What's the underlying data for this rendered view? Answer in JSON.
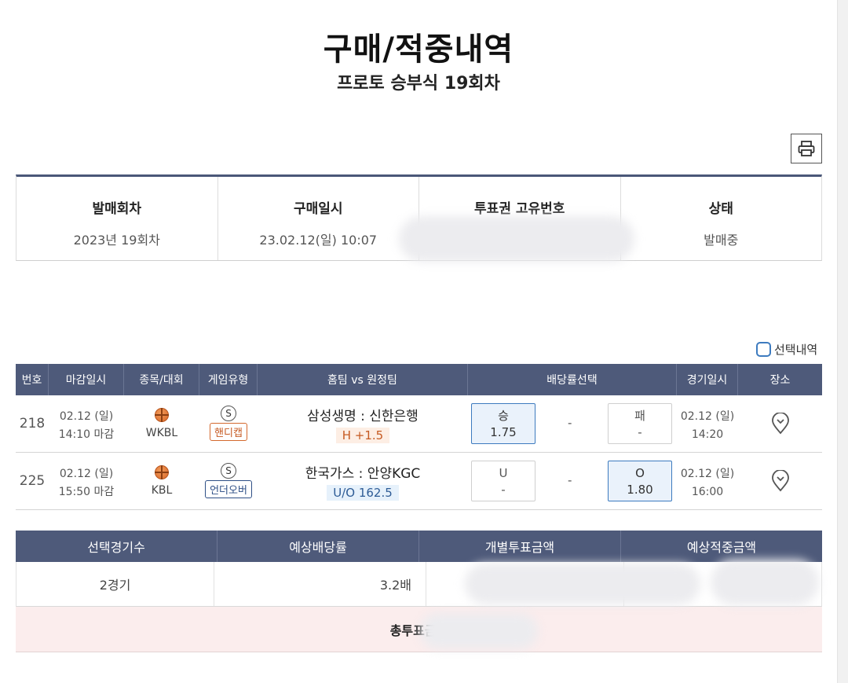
{
  "page": {
    "title": "구매/적중내역",
    "subtitle": "프로토 승부식 19회차"
  },
  "info": {
    "headers": [
      "발매회차",
      "구매일시",
      "투표권 고유번호",
      "상태"
    ],
    "values": [
      "2023년 19회차",
      "23.02.12(일) 10:07",
      "",
      "발매중"
    ]
  },
  "selection_toggle": {
    "label": "선택내역"
  },
  "games": {
    "headers": [
      "번호",
      "마감일시",
      "종목/대회",
      "게임유형",
      "홈팀 vs 원정팀",
      "배당률선택",
      "경기일시",
      "장소"
    ],
    "rows": [
      {
        "no": "218",
        "close_date": "02.12 (일)",
        "close_time": "14:10 마감",
        "league": "WKBL",
        "type_badge": "S",
        "type": "핸디캡",
        "teams": "삼성생명 : 신한은행",
        "line": "H +1.5",
        "odd_left_label": "승",
        "odd_left_value": "1.75",
        "odd_mid": "-",
        "odd_right_label": "패",
        "odd_right_value": "-",
        "selected": "left",
        "game_date": "02.12 (일)",
        "game_time": "14:20"
      },
      {
        "no": "225",
        "close_date": "02.12 (일)",
        "close_time": "15:50 마감",
        "league": "KBL",
        "type_badge": "S",
        "type": "언더오버",
        "teams": "한국가스 : 안양KGC",
        "line": "U/O 162.5",
        "odd_left_label": "U",
        "odd_left_value": "-",
        "odd_mid": "-",
        "odd_right_label": "O",
        "odd_right_value": "1.80",
        "selected": "right",
        "game_date": "02.12 (일)",
        "game_time": "16:00"
      }
    ]
  },
  "summary": {
    "headers": [
      "선택경기수",
      "예상배당률",
      "개별투표금액",
      "예상적중금액"
    ],
    "values": [
      "2경기",
      "3.2배",
      "",
      ""
    ],
    "total_label": "총투표금액"
  },
  "colors": {
    "header_bg": "#4e5a7a",
    "accent_blue": "#3d7bbf",
    "handicap_orange": "#c65a22",
    "total_bg": "#fbeded"
  },
  "icons": {
    "print": "printer-icon",
    "sport": "basketball-icon",
    "place": "location-pin-icon"
  }
}
